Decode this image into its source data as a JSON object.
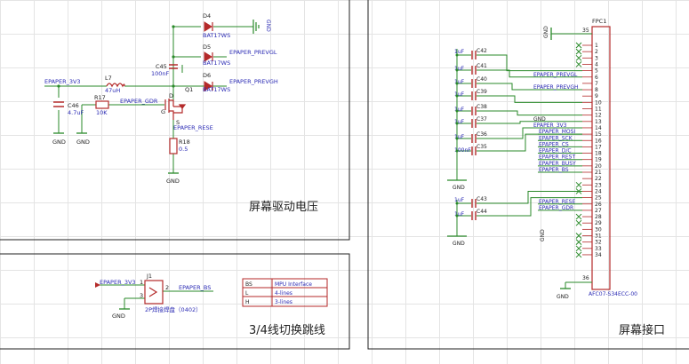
{
  "colors": {
    "wire": "#2a8a2a",
    "component": "#b42a2a",
    "net_label": "#2a2ab4",
    "frame": "#222222",
    "ref_text": "#222222"
  },
  "panels": {
    "drive_title": "屏幕驱动电压",
    "jumper_title": "3/4线切换跳线",
    "connector_title": "屏幕接口"
  },
  "drive_circuit": {
    "d4": {
      "ref": "D4",
      "value": "BAT17WS"
    },
    "d5": {
      "ref": "D5",
      "value": "BAT17WS"
    },
    "d6": {
      "ref": "D6",
      "value": "BAT17WS"
    },
    "c45": {
      "ref": "C45",
      "value": "100nF"
    },
    "l7": {
      "ref": "L7",
      "value": "47uH"
    },
    "c46": {
      "ref": "C46",
      "value": "4.7uF"
    },
    "r17": {
      "ref": "R17",
      "value": "10K"
    },
    "q1": {
      "ref": "Q1",
      "pin_d": "D",
      "pin_s": "S",
      "pin_g": "G"
    },
    "r18": {
      "ref": "R18",
      "value": "0.5"
    },
    "nets": {
      "gnd_top": "GND",
      "prevgl": "EPAPER_PREVGL",
      "prevgh": "EPAPER_PREVGH",
      "v3v3": "EPAPER_3V3",
      "gdr": "EPAPER_GDR",
      "rese": "EPAPER_RESE",
      "gnd1": "GND",
      "gnd2": "GND",
      "gnd3": "GND"
    }
  },
  "jumper": {
    "ref": "J1",
    "net_in": "EPAPER_3V3",
    "net_out": "EPAPER_BS",
    "gnd": "GND",
    "footprint": "2P焊接焊盘（0402）",
    "pins": [
      "1",
      "2",
      "3"
    ],
    "table": [
      [
        "BS",
        "MPU Interface"
      ],
      [
        "L",
        "4-lines"
      ],
      [
        "H",
        "3-lines"
      ]
    ]
  },
  "connector": {
    "ref": "FPC1",
    "part": "AFC07-S34ECC-00",
    "pins_top": [
      "35"
    ],
    "pins": [
      "1",
      "2",
      "3",
      "4",
      "5",
      "6",
      "7",
      "8",
      "9",
      "10",
      "11",
      "12",
      "13",
      "14",
      "15",
      "16",
      "17",
      "18",
      "19",
      "20",
      "21",
      "22",
      "23",
      "24",
      "25",
      "26",
      "27",
      "28",
      "29",
      "30",
      "31",
      "32",
      "33",
      "34"
    ],
    "pin_bottom": "36",
    "caps": [
      {
        "ref": "C42",
        "value": "1uF"
      },
      {
        "ref": "C41",
        "value": "1uF"
      },
      {
        "ref": "C40",
        "value": "1uF"
      },
      {
        "ref": "C39",
        "value": "1uF"
      },
      {
        "ref": "C38",
        "value": "1uF"
      },
      {
        "ref": "C37",
        "value": "1uF"
      },
      {
        "ref": "C36",
        "value": "1uF"
      },
      {
        "ref": "C35",
        "value": "100nF"
      },
      {
        "ref": "C43",
        "value": "1uF"
      },
      {
        "ref": "C44",
        "value": "1uF"
      }
    ],
    "net_labels": [
      {
        "text": "EPAPER_PREVGL"
      },
      {
        "text": "EPAPER_PREVGH"
      },
      {
        "text": "GND"
      },
      {
        "text": "EPAPER_3V3"
      },
      {
        "text": "EPAPER_MOSI"
      },
      {
        "text": "EPAPER_SCK"
      },
      {
        "text": "EPAPER_CS"
      },
      {
        "text": "EPAPER_D/C"
      },
      {
        "text": "EPAPER_REST"
      },
      {
        "text": "EPAPER_BUSY"
      },
      {
        "text": "EPAPER_BS"
      },
      {
        "text": "EPAPER_RESE"
      },
      {
        "text": "EPAPER_GDR"
      }
    ],
    "gnd_labels": [
      "GND",
      "GND",
      "GND",
      "GND",
      "GND"
    ]
  }
}
